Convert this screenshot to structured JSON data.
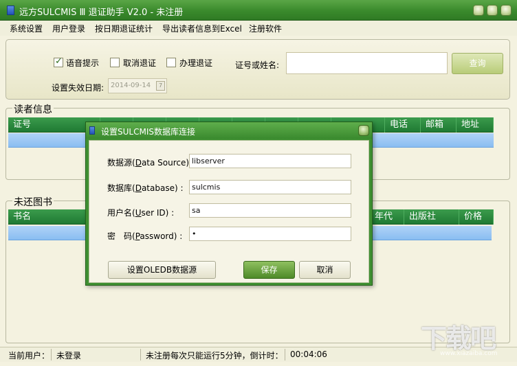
{
  "window": {
    "title": "远方SULCMIS Ⅲ 退证助手 V2.0 - 未注册"
  },
  "menu": [
    "系统设置",
    "用户登录",
    "按日期退证统计",
    "导出读者信息到Excel",
    "注册软件"
  ],
  "query": {
    "options": [
      {
        "label": "语音提示",
        "checked": true
      },
      {
        "label": "取消退证",
        "checked": false
      },
      {
        "label": "办理退证",
        "checked": false
      }
    ],
    "search_label": "证号或姓名:",
    "search_value": "",
    "query_button": "查询",
    "expiry_label": "设置失效日期:",
    "expiry_value": "2014-09-14",
    "calendar_glyph": "7"
  },
  "reader_group": {
    "title": "读者信息",
    "columns": [
      "证号",
      "",
      "",
      "",
      "",
      "",
      "",
      "",
      "",
      "电话",
      "邮箱",
      "地址"
    ]
  },
  "books_group": {
    "title": "未还图书",
    "columns": [
      "书名",
      "年代",
      "出版社",
      "价格"
    ]
  },
  "dialog": {
    "title": "设置SULCMIS数据库连接",
    "fields": [
      {
        "label_pre": "数据源(",
        "label_key": "D",
        "label_post": "ata Source) :",
        "value": "libserver"
      },
      {
        "label_pre": "数据库(",
        "label_key": "D",
        "label_post": "atabase) :",
        "value": "sulcmis"
      },
      {
        "label_pre": "用户名(",
        "label_key": "U",
        "label_post": "ser ID) :",
        "value": "sa"
      },
      {
        "label_pre": "密　码(",
        "label_key": "P",
        "label_post": "assword) :",
        "value": "•"
      }
    ],
    "oledb_button": "设置OLEDB数据源",
    "save_button": "保存",
    "cancel_button": "取消"
  },
  "status": {
    "user_label": "当前用户：",
    "user_value": "未登录",
    "notice": "未注册每次只能运行5分钟，倒计时：",
    "timer": "00:04:06"
  },
  "watermark": {
    "logo": "下载吧",
    "url": "www.xiazaiba.com"
  }
}
